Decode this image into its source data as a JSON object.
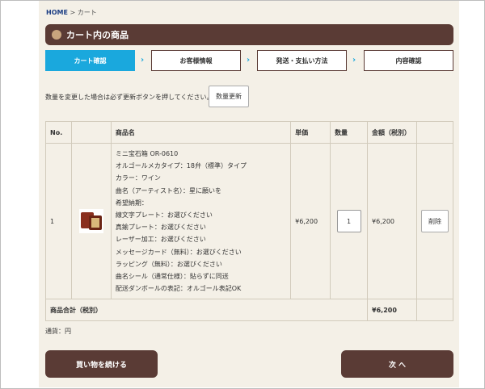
{
  "breadcrumb": {
    "home": "HOME",
    "separator": " > ",
    "current": "カート"
  },
  "page_title": "カート内の商品",
  "steps": [
    {
      "label": "カート確認"
    },
    {
      "label": "お客様情報"
    },
    {
      "label": "発送・支払い方法"
    },
    {
      "label": "内容確認"
    }
  ],
  "step_arrow": "›",
  "notice": "数量を変更した場合は必ず更新ボタンを押してください。",
  "update_button": "数量更新",
  "table": {
    "headers": {
      "no": "No.",
      "name": "商品名",
      "price": "単価",
      "qty": "数量",
      "amount": "金額（税別）"
    },
    "row": {
      "no": "1",
      "lines": [
        "ミニ宝石箱 OR-0610",
        "オルゴールメカタイプ：18弁（標準）タイプ",
        "カラー：ワイン",
        "曲名（アーティスト名）：星に願いを",
        "希望納期：",
        "線文字プレート：お選びください",
        "真鍮プレート：お選びください",
        "レーザー加工：お選びください",
        "メッセージカード（無料）：お選びください",
        "ラッピング（無料）：お選びください",
        "曲名シール（通常仕様）：貼らずに同送",
        "配送ダンボールの表記：オルゴール表記OK"
      ],
      "price": "¥6,200",
      "qty": "1",
      "amount": "¥6,200",
      "delete": "削除"
    },
    "total_label": "商品合計（税別）",
    "total_value": "¥6,200"
  },
  "currency_note": "通貨：円",
  "continue_button": "買い物を続ける",
  "next_button": "次 へ"
}
